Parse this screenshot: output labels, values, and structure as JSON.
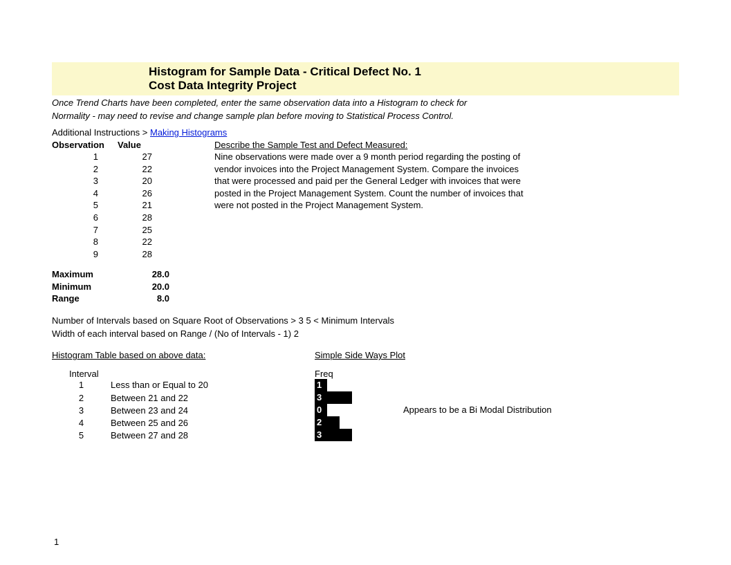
{
  "title": {
    "line1": "Histogram for Sample Data - Critical Defect No. 1",
    "line2": "Cost Data Integrity Project"
  },
  "intro": {
    "line1": "Once Trend Charts have been completed, enter the same observation data into a Histogram to check for",
    "line2": "Normality - may need to revise and change sample plan before moving to Statistical Process Control."
  },
  "additional_label": "Additional Instructions >  ",
  "additional_link": "Making Histograms",
  "obs": {
    "head_col1": "Observation",
    "head_col2": "Value",
    "rows": [
      {
        "n": "1",
        "v": "27"
      },
      {
        "n": "2",
        "v": "22"
      },
      {
        "n": "3",
        "v": "20"
      },
      {
        "n": "4",
        "v": "26"
      },
      {
        "n": "5",
        "v": "21"
      },
      {
        "n": "6",
        "v": "28"
      },
      {
        "n": "7",
        "v": "25"
      },
      {
        "n": "8",
        "v": "22"
      },
      {
        "n": "9",
        "v": "28"
      }
    ]
  },
  "desc": {
    "head": "Describe the Sample Test and Defect Measured:",
    "l1": "Nine observations were made over a 9 month period regarding the posting of",
    "l2": "vendor invoices into the Project Management System. Compare the invoices",
    "l3": "that were processed and paid per the General Ledger with invoices that were",
    "l4": "posted in the Project Management System. Count the number of invoices that",
    "l5": "were not posted in the Project Management System."
  },
  "stats": {
    "max_label": "Maximum",
    "max_val": "28.0",
    "min_label": "Minimum",
    "min_val": "20.0",
    "range_label": "Range",
    "range_val": "8.0"
  },
  "calc": {
    "line1": "Number of Intervals based on Square Root of Observations >  3   5  < Minimum Intervals",
    "line2": "Width of each interval based on Range / (No of Intervals - 1)    2"
  },
  "hist_heads": {
    "h1": "Histogram Table based on above data:",
    "h2": "Simple Side Ways Plot"
  },
  "interval_head": "Interval",
  "freq_head": "Freq",
  "intervals": [
    {
      "n": "1",
      "label": "Less than or Equal to 20",
      "freq": "1",
      "annot": ""
    },
    {
      "n": "2",
      "label": "Between 21 and 22",
      "freq": "3",
      "annot": ""
    },
    {
      "n": "3",
      "label": "Between 23 and 24",
      "freq": "0",
      "annot": "Appears to be a Bi Modal Distribution"
    },
    {
      "n": "4",
      "label": "Between 25 and 26",
      "freq": "2",
      "annot": ""
    },
    {
      "n": "5",
      "label": "Between 27 and 28",
      "freq": "3",
      "annot": ""
    }
  ],
  "page_number": "1",
  "chart_data": {
    "type": "bar",
    "title": "Simple Side Ways Plot",
    "categories": [
      "Less than or Equal to 20",
      "Between 21 and 22",
      "Between 23 and 24",
      "Between 25 and 26",
      "Between 27 and 28"
    ],
    "values": [
      1,
      3,
      0,
      2,
      3
    ],
    "xlabel": "Freq",
    "ylabel": "Interval",
    "annotation": "Appears to be a Bi Modal Distribution"
  }
}
